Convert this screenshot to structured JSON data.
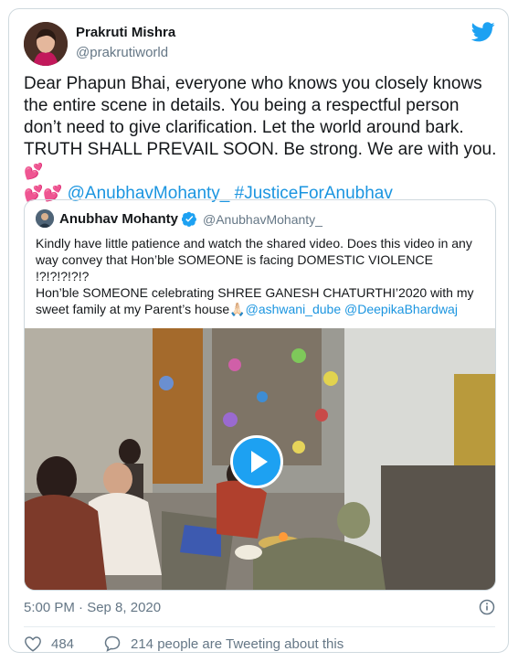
{
  "tweet": {
    "author_name": "Prakruti Mishra",
    "author_handle": "@prakrutiworld",
    "text_main": "Dear Phapun Bhai, everyone who knows you closely knows the entire scene in details. You being a respectful person don’t need to give clarification. Let the world around bark. TRUTH SHALL PREVAIL SOON. Be strong. We are with you.",
    "emoji_hearts_1": "💕",
    "emoji_hearts_2": "💕💕",
    "mention": "@AnubhavMohanty_",
    "hashtag": "#JusticeForAnubhav",
    "timestamp": "5:00 PM · Sep 8, 2020",
    "likes": "484",
    "retweet_text": "214 people are Tweeting about this"
  },
  "quoted": {
    "name": "Anubhav Mohanty",
    "handle": "@AnubhavMohanty_",
    "line1": "Kindly have little patience and watch the shared video. Does this video in any way convey that Hon’ble SOMEONE is facing DOMESTIC VIOLENCE !?!?!?!?!?",
    "line2": "Hon’ble SOMEONE celebrating SHREE GANESH CHATURTHI’2020 with my sweet family at my Parent’s house",
    "emoji_pray": "🙏🏻",
    "mention1": "@ashwani_dube",
    "mention2": "@DeepikaBhardwaj"
  },
  "icons": {
    "brand": "twitter-bird-icon",
    "verified": "verified-badge-icon",
    "play": "play-icon",
    "info": "info-icon",
    "like": "heart-icon",
    "retweet": "speech-bubble-icon"
  },
  "colors": {
    "brand_blue": "#1da1f2",
    "link_blue": "#1b95e0",
    "muted": "#657786",
    "heart": "#e0245e"
  }
}
